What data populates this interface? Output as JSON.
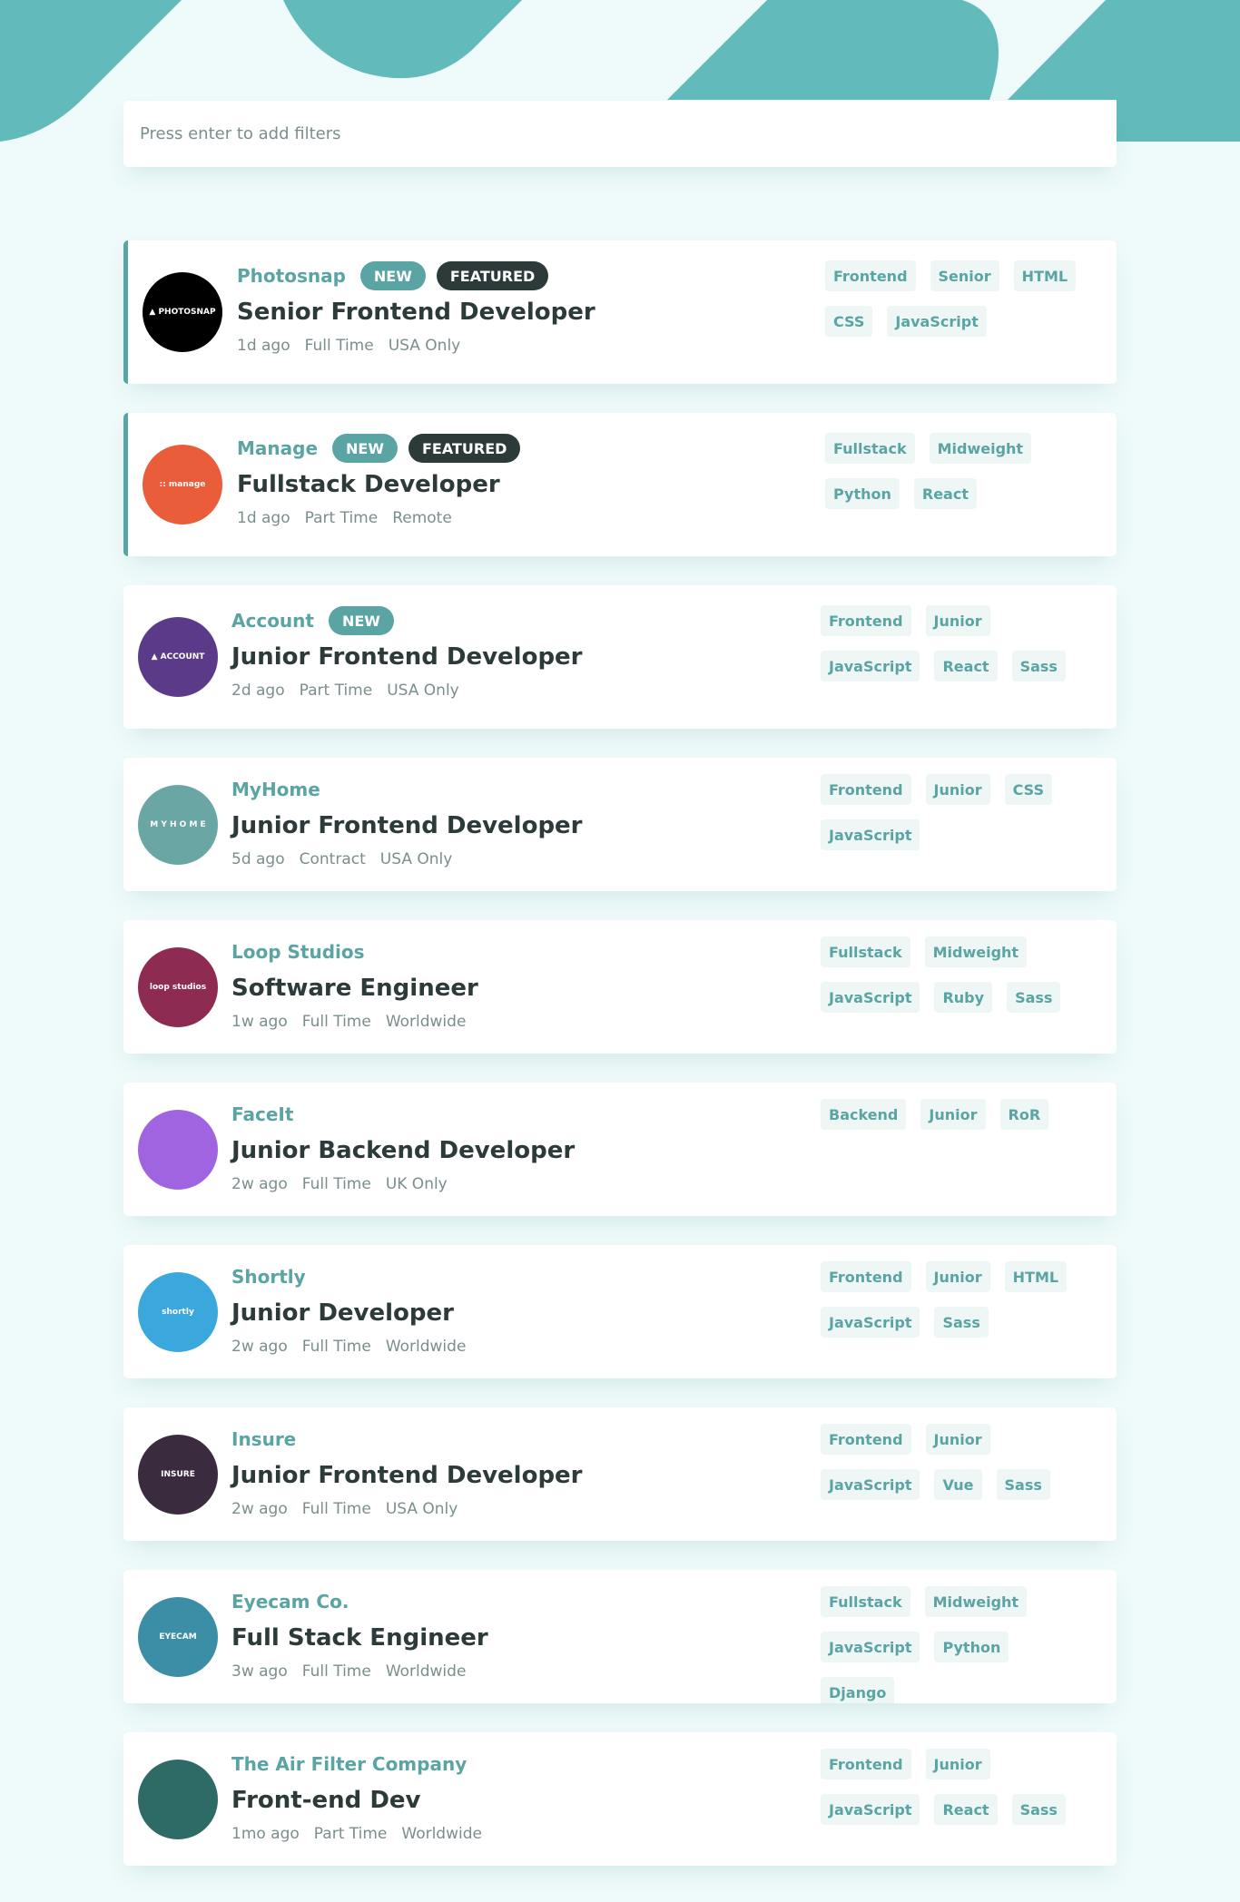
{
  "colors": {
    "primary": "#5ba4a4",
    "dark": "#2c3a3a",
    "muted": "#7b8e8e",
    "background": "#effafa",
    "tag_background": "#eef6f6"
  },
  "search": {
    "placeholder": "Press enter to add filters"
  },
  "jobs": [
    {
      "company": "Photosnap",
      "logo_text": "▲ PHOTOSNAP",
      "logo_color": "#000000",
      "new": "NEW",
      "featured": "FEATURED",
      "position": "Senior Frontend Developer",
      "posted": "1d ago",
      "contract": "Full Time",
      "location": "USA Only",
      "tags": [
        "Frontend",
        "Senior",
        "HTML",
        "CSS",
        "JavaScript"
      ]
    },
    {
      "company": "Manage",
      "logo_text": ":: manage",
      "logo_color": "#ea5d3a",
      "new": "NEW",
      "featured": "FEATURED",
      "position": "Fullstack Developer",
      "posted": "1d ago",
      "contract": "Part Time",
      "location": "Remote",
      "tags": [
        "Fullstack",
        "Midweight",
        "Python",
        "React"
      ]
    },
    {
      "company": "Account",
      "logo_text": "▲ ACCOUNT",
      "logo_color": "#5b3a8a",
      "new": "NEW",
      "position": "Junior Frontend Developer",
      "posted": "2d ago",
      "contract": "Part Time",
      "location": "USA Only",
      "tags": [
        "Frontend",
        "Junior",
        "JavaScript",
        "React",
        "Sass"
      ]
    },
    {
      "company": "MyHome",
      "logo_text": "M Y H O M E",
      "logo_color": "#6aa7a4",
      "position": "Junior Frontend Developer",
      "posted": "5d ago",
      "contract": "Contract",
      "location": "USA Only",
      "tags": [
        "Frontend",
        "Junior",
        "CSS",
        "JavaScript"
      ]
    },
    {
      "company": "Loop Studios",
      "logo_text": "loop studios",
      "logo_color": "#8e2b53",
      "position": "Software Engineer",
      "posted": "1w ago",
      "contract": "Full Time",
      "location": "Worldwide",
      "tags": [
        "Fullstack",
        "Midweight",
        "JavaScript",
        "Ruby",
        "Sass"
      ]
    },
    {
      "company": "FaceIt",
      "logo_text": "",
      "logo_color": "#a064e0",
      "position": "Junior Backend Developer",
      "posted": "2w ago",
      "contract": "Full Time",
      "location": "UK Only",
      "tags": [
        "Backend",
        "Junior",
        "RoR"
      ]
    },
    {
      "company": "Shortly",
      "logo_text": "shortly",
      "logo_color": "#3aa8dc",
      "position": "Junior Developer",
      "posted": "2w ago",
      "contract": "Full Time",
      "location": "Worldwide",
      "tags": [
        "Frontend",
        "Junior",
        "HTML",
        "JavaScript",
        "Sass"
      ]
    },
    {
      "company": "Insure",
      "logo_text": "INSURE",
      "logo_color": "#3b2b3e",
      "position": "Junior Frontend Developer",
      "posted": "2w ago",
      "contract": "Full Time",
      "location": "USA Only",
      "tags": [
        "Frontend",
        "Junior",
        "JavaScript",
        "Vue",
        "Sass"
      ]
    },
    {
      "company": "Eyecam Co.",
      "logo_text": "EYECAM",
      "logo_color": "#3b8ea6",
      "position": "Full Stack Engineer",
      "posted": "3w ago",
      "contract": "Full Time",
      "location": "Worldwide",
      "tags": [
        "Fullstack",
        "Midweight",
        "JavaScript",
        "Python",
        "Django"
      ]
    },
    {
      "company": "The Air Filter Company",
      "logo_text": "",
      "logo_color": "#2e6b66",
      "position": "Front-end Dev",
      "posted": "1mo ago",
      "contract": "Part Time",
      "location": "Worldwide",
      "tags": [
        "Frontend",
        "Junior",
        "JavaScript",
        "React",
        "Sass"
      ]
    }
  ]
}
